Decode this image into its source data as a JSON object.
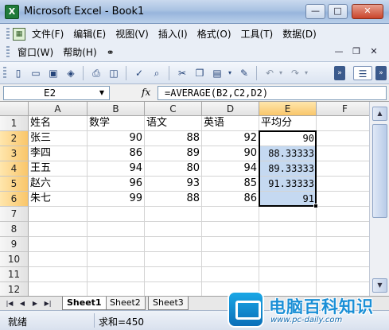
{
  "window": {
    "title": "Microsoft Excel - Book1",
    "app_icon": "X",
    "minimize": "—",
    "maximize": "□",
    "close": "✕"
  },
  "menu": {
    "items": [
      "文件(F)",
      "编辑(E)",
      "视图(V)",
      "插入(I)",
      "格式(O)",
      "工具(T)",
      "数据(D)"
    ],
    "row2": [
      "窗口(W)",
      "帮助(H)"
    ],
    "mdi_min": "—",
    "mdi_restore": "❐",
    "mdi_close": "✕"
  },
  "formula_bar": {
    "name_box": "E2",
    "fx": "fx",
    "formula": "=AVERAGE(B2,C2,D2)"
  },
  "columns": [
    "A",
    "B",
    "C",
    "D",
    "E",
    "F"
  ],
  "selected_column": "E",
  "rows": [
    "1",
    "2",
    "3",
    "4",
    "5",
    "6",
    "7",
    "8",
    "9",
    "10",
    "11",
    "12"
  ],
  "cells": {
    "header": [
      "姓名",
      "数学",
      "语文",
      "英语",
      "平均分"
    ],
    "data": [
      [
        "张三",
        "90",
        "88",
        "92",
        "90"
      ],
      [
        "李四",
        "86",
        "89",
        "90",
        "88.33333"
      ],
      [
        "王五",
        "94",
        "80",
        "94",
        "89.33333"
      ],
      [
        "赵六",
        "96",
        "93",
        "85",
        "91.33333"
      ],
      [
        "朱七",
        "99",
        "88",
        "86",
        "91"
      ]
    ]
  },
  "sheets": [
    "Sheet1",
    "Sheet2",
    "Sheet3"
  ],
  "active_sheet": "Sheet1",
  "status": {
    "ready": "就绪",
    "sum": "求和=450"
  },
  "watermark": {
    "title": "电脑百科知识",
    "url": "www.pc-daily.com"
  },
  "colors": {
    "selection": "#c5d9f1",
    "header_selected": "#f9c66a",
    "titlebar": "#a9c2e2"
  }
}
